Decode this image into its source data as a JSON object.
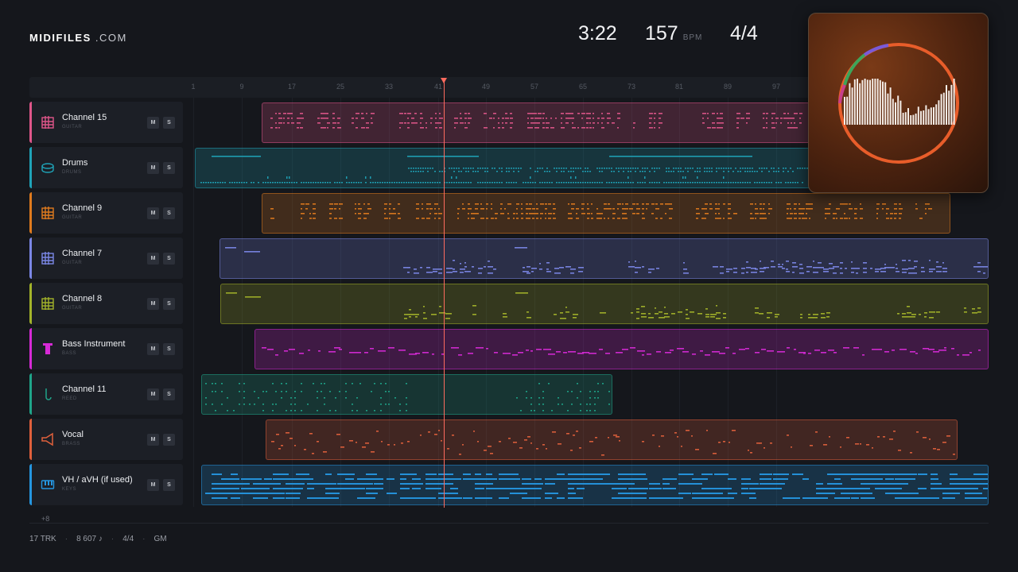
{
  "brand": {
    "name_bold": "MIDIFILES",
    "name_light": ".COM"
  },
  "transport": {
    "time": "3:22",
    "bpm": "157",
    "bpm_unit": "BPM",
    "time_signature": "4/4"
  },
  "ruler": {
    "ticks": [
      "1",
      "9",
      "17",
      "25",
      "33",
      "41",
      "49",
      "57",
      "65",
      "73",
      "81",
      "89",
      "97"
    ]
  },
  "tracks": [
    {
      "name": "Channel 15",
      "category": "GUITAR",
      "icon": "guitar-grid-icon",
      "color": "#e0568a",
      "mute": "M",
      "solo": "S",
      "style": "chords"
    },
    {
      "name": "Drums",
      "category": "DRUMS",
      "icon": "drum-icon",
      "color": "#1fa3b8",
      "mute": "M",
      "solo": "S",
      "style": "drums"
    },
    {
      "name": "Channel 9",
      "category": "GUITAR",
      "icon": "guitar-grid-icon",
      "color": "#e07b1e",
      "mute": "M",
      "solo": "S",
      "style": "chords"
    },
    {
      "name": "Channel 7",
      "category": "GUITAR",
      "icon": "guitar-grid-icon",
      "color": "#7b87e6",
      "mute": "M",
      "solo": "S",
      "style": "melody"
    },
    {
      "name": "Channel 8",
      "category": "GUITAR",
      "icon": "guitar-grid-icon",
      "color": "#a3b32a",
      "mute": "M",
      "solo": "S",
      "style": "melody"
    },
    {
      "name": "Bass Instrument",
      "category": "BASS",
      "icon": "bass-icon",
      "color": "#d62ad6",
      "mute": "M",
      "solo": "S",
      "style": "bass"
    },
    {
      "name": "Channel 11",
      "category": "REED",
      "icon": "reed-icon",
      "color": "#1fa58a",
      "mute": "M",
      "solo": "S",
      "style": "sparse"
    },
    {
      "name": "Vocal",
      "category": "BRASS",
      "icon": "brass-icon",
      "color": "#e0603c",
      "mute": "M",
      "solo": "S",
      "style": "vocal"
    },
    {
      "name": "VH / aVH (if used)",
      "category": "KEYS",
      "icon": "keys-icon",
      "color": "#2596e0",
      "mute": "M",
      "solo": "S",
      "style": "keys"
    }
  ],
  "more_tracks": "+8",
  "footer": {
    "tracks": "17 TRK",
    "notes": "8 607 ♪",
    "signature": "4/4",
    "standard": "GM"
  }
}
